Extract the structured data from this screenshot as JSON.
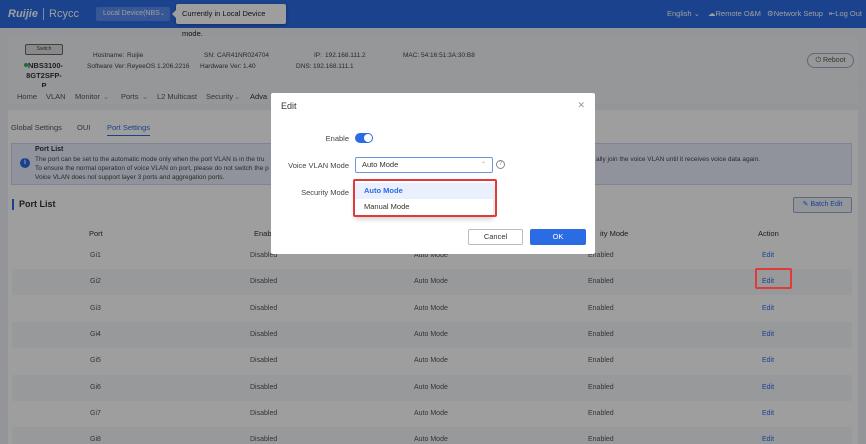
{
  "topbar": {
    "brand_ruijie": "Ruijie",
    "brand_reyee": "Rcycc",
    "device_select": "Local Device(NBS",
    "tooltip": "Currently in Local Device mode.",
    "language": "English",
    "remote_om": "Remote O&M",
    "network_setup": "Network Setup",
    "logout": "Log Out"
  },
  "device": {
    "icon_label": "Switch",
    "name_line1": "NBS3100-",
    "name_line2": "8GT2SFP-P",
    "hostname_label": "Hostname:",
    "hostname": "Ruijie",
    "sn_label": "SN:",
    "sn": "CAR41NR024704",
    "ip_label": "IP:",
    "ip": "192.168.111.2",
    "mac_label": "MAC:",
    "mac": "54:16:51:3A:30:B8",
    "software_label": "Software Ver:",
    "software": "ReyeeOS 1.206.2216",
    "hardware_label": "Hardware Ver:",
    "hardware": "1.40",
    "dns_label": "DNS:",
    "dns": "192.168.111.1",
    "reboot": "Reboot"
  },
  "nav": [
    "Home",
    "VLAN",
    "Monitor",
    "Ports",
    "L2 Multicast",
    "Security",
    "Adva"
  ],
  "subtabs": [
    "Global Settings",
    "OUI",
    "Port Settings"
  ],
  "notice": {
    "title": "Port List",
    "line1": "The port can be set to the automatic mode only when the port VLAN is in the tru",
    "line1_right": "ally join the voice VLAN until it receives voice data again.",
    "line2": "To ensure the normal operation of voice VLAN on port, please do not switch the p",
    "line3": "Voice VLAN does not support layer 3 ports and aggregation ports."
  },
  "port_list": {
    "title": "Port List",
    "batch_edit": "Batch Edit",
    "headers": [
      "Port",
      "Enab",
      "",
      "ity Mode",
      "Action"
    ],
    "rows": [
      [
        "Gi1",
        "Disabled",
        "Auto Mode",
        "Enabled",
        "Edit"
      ],
      [
        "Gi2",
        "Disabled",
        "Auto Mode",
        "Enabled",
        "Edit"
      ],
      [
        "Gi3",
        "Disabled",
        "Auto Mode",
        "Enabled",
        "Edit"
      ],
      [
        "Gi4",
        "Disabled",
        "Auto Mode",
        "Enabled",
        "Edit"
      ],
      [
        "Gi5",
        "Disabled",
        "Auto Mode",
        "Enabled",
        "Edit"
      ],
      [
        "Gi6",
        "Disabled",
        "Auto Mode",
        "Enabled",
        "Edit"
      ],
      [
        "Gi7",
        "Disabled",
        "Auto Mode",
        "Enabled",
        "Edit"
      ],
      [
        "Gi8",
        "Disabled",
        "Auto Mode",
        "Enabled",
        "Edit"
      ]
    ]
  },
  "modal": {
    "title": "Edit",
    "enable_label": "Enable",
    "voice_vlan_mode_label": "Voice VLAN Mode",
    "voice_vlan_mode_value": "Auto Mode",
    "security_mode_label": "Security Mode",
    "options": [
      "Auto Mode",
      "Manual Mode"
    ],
    "cancel": "Cancel",
    "ok": "OK"
  },
  "colors": {
    "primary": "#2b6be4",
    "highlight": "#e03a3a"
  }
}
